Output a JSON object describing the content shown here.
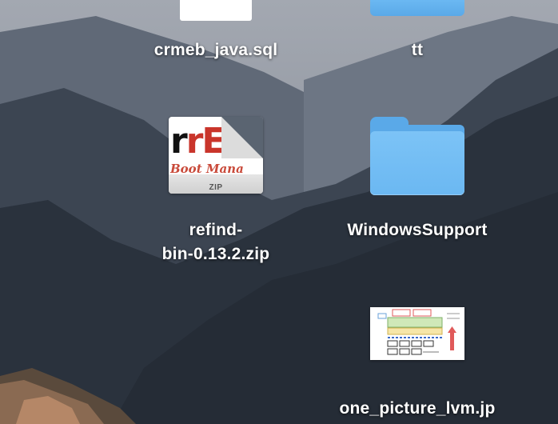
{
  "desktop": {
    "items": [
      {
        "label": "crmeb_java.sql",
        "icon": "sql-document-icon"
      },
      {
        "label": "tt",
        "icon": "folder-icon"
      },
      {
        "label_line1": "refind-",
        "label_line2": "bin-0.13.2.zip",
        "icon": "zip-archive-icon",
        "badge_text": "rEFI",
        "badge_sub": "Boot Mana",
        "ext": "ZIP"
      },
      {
        "label": "WindowsSupport",
        "icon": "folder-icon"
      },
      {
        "label": "one_picture_lvm.jp",
        "icon": "image-thumbnail-icon"
      }
    ]
  },
  "colors": {
    "folder_front": "#7cc3f6",
    "folder_back": "#5aa9e8",
    "label_text": "#ffffff"
  }
}
